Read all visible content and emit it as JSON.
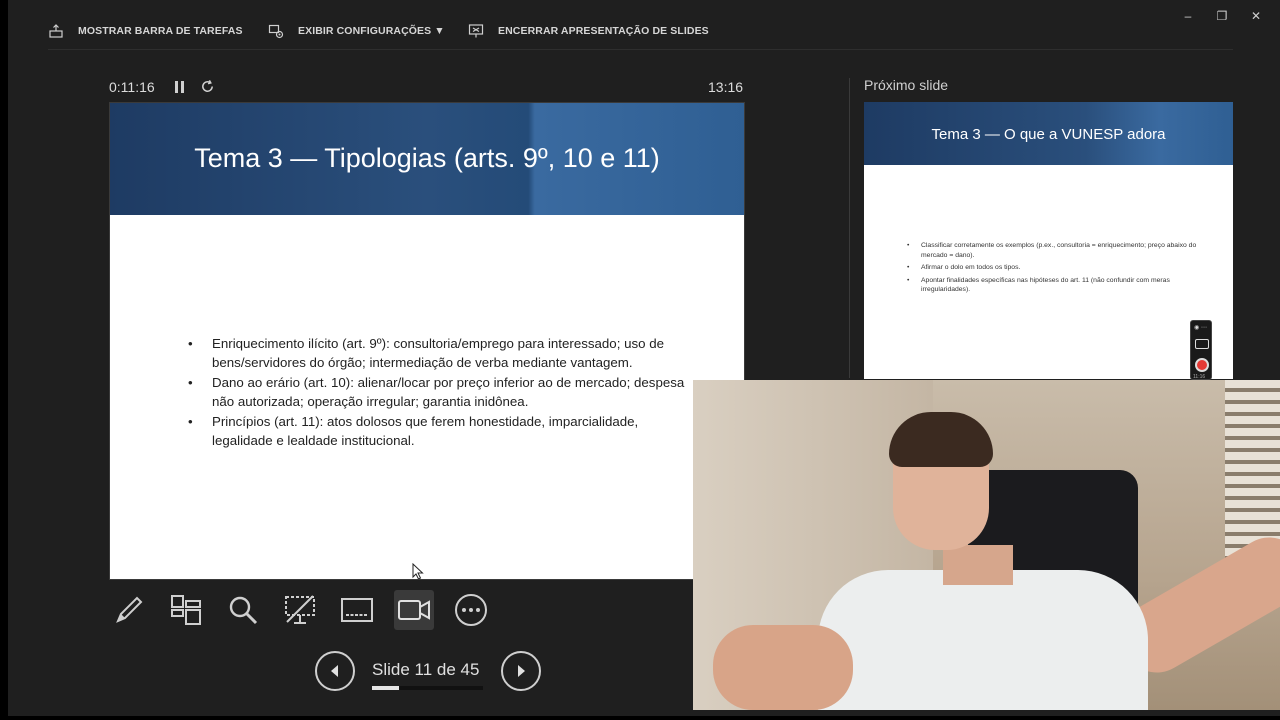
{
  "toolbar": {
    "taskbar_label": "MOSTRAR BARRA DE TAREFAS",
    "display_settings_label": "EXIBIR CONFIGURAÇÕES ▼",
    "end_show_label": "ENCERRAR APRESENTAÇÃO DE SLIDES"
  },
  "window_controls": {
    "minimize": "–",
    "restore": "❐",
    "close": "✕"
  },
  "presenter": {
    "elapsed": "0:11:16",
    "clock": "13:16"
  },
  "current_slide": {
    "title": "Tema 3 — Tipologias (arts. 9º, 10 e 11)",
    "bullets": [
      "Enriquecimento ilícito (art. 9º): consultoria/emprego para interessado; uso de bens/servidores do órgão; intermediação de verba mediante vantagem.",
      "Dano ao erário (art. 10): alienar/locar por preço inferior ao de mercado; despesa não autorizada; operação irregular; garantia inidônea.",
      "Princípios (art. 11): atos dolosos que ferem honestidade, imparcialidade, legalidade e lealdade institucional."
    ]
  },
  "tools": [
    {
      "name": "pen-icon"
    },
    {
      "name": "all-slides-icon"
    },
    {
      "name": "zoom-icon"
    },
    {
      "name": "black-screen-icon"
    },
    {
      "name": "subtitles-icon"
    },
    {
      "name": "camera-icon"
    },
    {
      "name": "more-options-icon"
    }
  ],
  "navigation": {
    "counter": "Slide 11 de 45",
    "current": 11,
    "total": 45
  },
  "next_slide": {
    "label": "Próximo slide",
    "title": "Tema 3 — O que a VUNESP adora",
    "bullets": [
      "Classificar corretamente os exemplos (p.ex., consultoria = enriquecimento; preço abaixo do mercado = dano).",
      "Afirmar o dolo em todos os tipos.",
      "Apontar finalidades específicas nas hipóteses do art. 11 (não confundir com meras irregularidades)."
    ]
  },
  "recorder": {
    "time": "11:16"
  }
}
